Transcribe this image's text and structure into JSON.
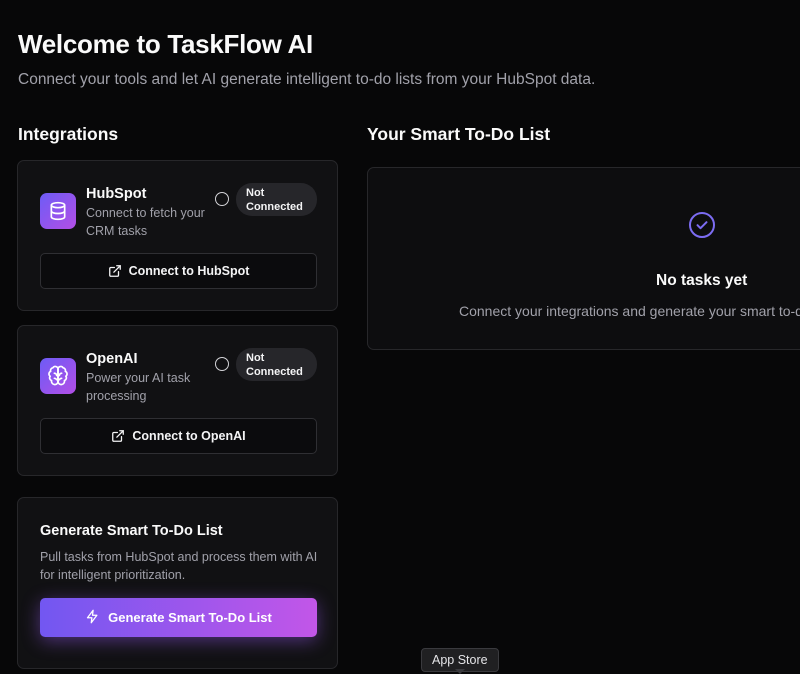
{
  "header": {
    "title": "Welcome to TaskFlow AI",
    "subtitle": "Connect your tools and let AI generate intelligent to-do lists from your HubSpot data."
  },
  "integrations": {
    "section_title": "Integrations",
    "items": [
      {
        "name": "HubSpot",
        "description": "Connect to fetch your CRM tasks",
        "icon": "database-icon",
        "status_line1": "Not",
        "status_line2": "Connected",
        "button_label": "Connect to HubSpot",
        "button_icon": "external-link-icon"
      },
      {
        "name": "OpenAI",
        "description": "Power your AI task processing",
        "icon": "brain-icon",
        "status_line1": "Not",
        "status_line2": "Connected",
        "button_label": "Connect to OpenAI",
        "button_icon": "external-link-icon"
      }
    ]
  },
  "generate": {
    "title": "Generate Smart To-Do List",
    "description": "Pull tasks from HubSpot and process them with AI for intelligent prioritization.",
    "button_label": "Generate Smart To-Do List",
    "button_icon": "lightning-icon"
  },
  "todo": {
    "section_title": "Your Smart To-Do List",
    "empty_title": "No tasks yet",
    "empty_description": "Connect your integrations and generate your smart to-do list to get started.",
    "empty_icon": "check-circle-icon"
  },
  "tooltip": {
    "label": "App Store"
  },
  "colors": {
    "background": "#070708",
    "card": "#111113",
    "border": "#27272a",
    "accent_start": "#7257f1",
    "accent_end": "#c256e8",
    "check_icon": "#7c6cf2",
    "muted_text": "#a1a1aa"
  }
}
